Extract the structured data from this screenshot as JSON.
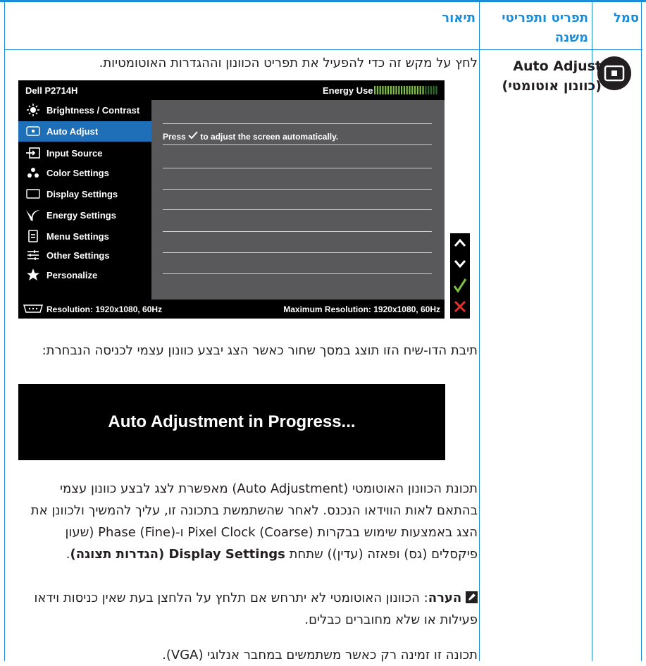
{
  "table": {
    "headers": {
      "icon": "סמל",
      "menu": "תפריט ותפריטי",
      "menu2": "משנה",
      "desc": "תיאור"
    },
    "feature": {
      "name": "Auto Adjust",
      "name_he": "(כוונון אוטומטי)"
    },
    "intro": "לחץ על מקש זה כדי להפעיל את תפריט הכוונון וההגדרות האוטומטיות.",
    "dialog_text": "תיבת הדו-שיח הזו תוצג במסך שחור כאשר הצג יבצע כוונון עצמי לכניסה הנבחרת:",
    "p1": "תכונת הכוונון האוטומטי (Auto Adjustment) מאפשרת לצג לבצע כוונון עצמי בהתאם לאות הווידאו הנכנס. לאחר שהשתמשת בתכונה זו, עליך להמשיך ולכוונן את הצג באמצעות שימוש בבקרות Pixel Clock (Coarse)‏ ו-Phase (Fine)‏ (שעון פיקסלים (גס) ופאזה (עדין)) שתחת",
    "p1_bold": "Display Settings (הגדרות תצוגה)",
    "p1_end": ".",
    "note_label": "הערה",
    "note_text": ": הכוונון האוטומטי לא יתרחש אם תלחץ על הלחצן בעת שאין כניסות וידאו פעילות או שלא מחוברים כבלים.",
    "last": "תכונה זו זמינה רק כאשר משתמשים במחבר אנלוגי (VGA)."
  },
  "osd": {
    "model": "Dell P2714H",
    "energy_label": "Energy Use",
    "energy_level": 0.8,
    "items": [
      {
        "label": "Brightness / Contrast",
        "icon": "sun-icon"
      },
      {
        "label": "Auto Adjust",
        "icon": "auto-adjust-icon"
      },
      {
        "label": "Input Source",
        "icon": "input-source-icon"
      },
      {
        "label": "Color Settings",
        "icon": "color-dots-icon"
      },
      {
        "label": "Display Settings",
        "icon": "display-rect-icon"
      },
      {
        "label": "Energy Settings",
        "icon": "leaf-icon"
      },
      {
        "label": "Menu Settings",
        "icon": "menu-doc-icon"
      },
      {
        "label": "Other Settings",
        "icon": "sliders-icon"
      },
      {
        "label": "Personalize",
        "icon": "star-icon"
      }
    ],
    "selected_index": 1,
    "message_press": "Press",
    "message_rest": "to adjust the screen automatically.",
    "resolution": "Resolution: 1920x1080, 60Hz",
    "max_resolution": "Maximum Resolution: 1920x1080, 60Hz",
    "colors": {
      "selected": "#1e6fb8",
      "check": "#7dc243",
      "close": "#e4312b",
      "energy_on": "#7dc243",
      "energy_off": "#2e6b2a"
    }
  },
  "banner": {
    "text": "Auto Adjustment in Progress..."
  }
}
